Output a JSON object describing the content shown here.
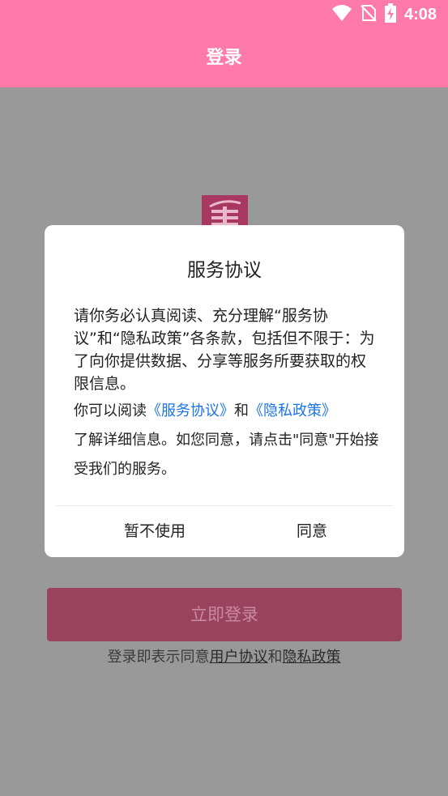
{
  "statusbar": {
    "time": "4:08"
  },
  "appbar": {
    "title": "登录"
  },
  "login": {
    "button_label": "立即登录",
    "terms_prefix": "登录即表示同意",
    "user_agreement": "用户协议",
    "and": "和",
    "privacy_policy": "隐私政策"
  },
  "dialog": {
    "title": "服务协议",
    "body": "请你务必认真阅读、充分理解“服务协议”和“隐私政策”各条款，包括但不限于：为了向你提供数据、分享等服务所要获取的权限信息。",
    "read_prefix": "你可以阅读",
    "service_link": "《服务协议》",
    "and": "和",
    "privacy_link": "《隐私政策》",
    "read_suffix": "了解详细信息。如您同意，请点击\"同意\"开始接受我们的服务。",
    "decline_button": "暂不使用",
    "agree_button": "同意"
  },
  "colors": {
    "brand_pink": "#ff7aa8",
    "overlay_gray": "#999999",
    "link_blue": "#1a73e8",
    "login_button_dimmed": "#99435f"
  }
}
